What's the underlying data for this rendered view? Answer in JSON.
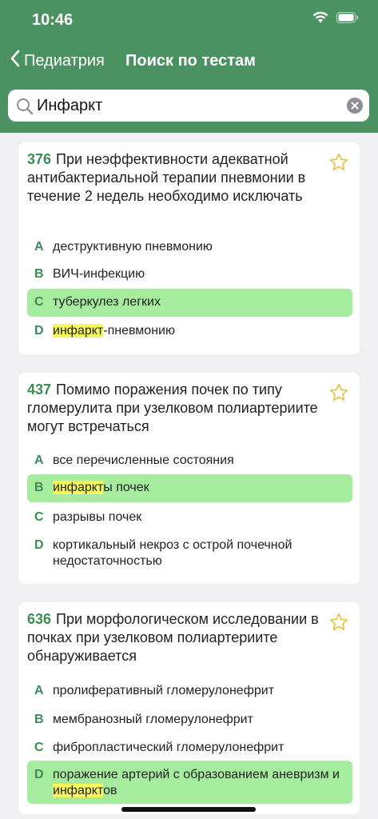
{
  "status": {
    "time": "10:46"
  },
  "nav": {
    "back_label": "Педиатрия",
    "title": "Поиск по тестам"
  },
  "search": {
    "value": "Инфаркт",
    "placeholder": ""
  },
  "colors": {
    "header": "#4a9262",
    "accent": "#3f8a57",
    "correct": "#a5ec9e",
    "highlight": "#f6f75a"
  },
  "cards": [
    {
      "number": "376",
      "question": "При неэффективности адекватной антибактериальной терапии пневмонии в течение 2 недель необходимо исключать",
      "answers": [
        {
          "letter": "A",
          "text": "деструктивную пневмонию"
        },
        {
          "letter": "B",
          "text": "ВИЧ-инфекцию"
        },
        {
          "letter": "C",
          "text": "туберкулез легких",
          "correct": true
        },
        {
          "letter": "D",
          "hl": "инфаркт",
          "rest": "-пневмонию"
        }
      ]
    },
    {
      "number": "437",
      "question": "Помимо поражения почек по типу гломерулита при узелковом полиартериите могут встречаться",
      "answers": [
        {
          "letter": "A",
          "text": "все перечисленные состояния"
        },
        {
          "letter": "B",
          "hl": "инфаркт",
          "rest": "ы почек",
          "correct": true
        },
        {
          "letter": "C",
          "text": "разрывы почек"
        },
        {
          "letter": "D",
          "text": "кортикальный некроз с острой почечной недостаточностью"
        }
      ]
    },
    {
      "number": "636",
      "question": "При морфологическом исследовании в почках при узелковом полиартериите обнаруживается",
      "answers": [
        {
          "letter": "A",
          "text": "пролиферативный гломерулонефрит"
        },
        {
          "letter": "B",
          "text": "мембранозный гломерулонефрит"
        },
        {
          "letter": "C",
          "text": "фибропластический гломерулонефрит"
        },
        {
          "letter": "D",
          "pre": "поражение артерий с образованием аневризм и ",
          "hl": "инфаркт",
          "rest": "ов",
          "correct": true
        }
      ]
    }
  ]
}
